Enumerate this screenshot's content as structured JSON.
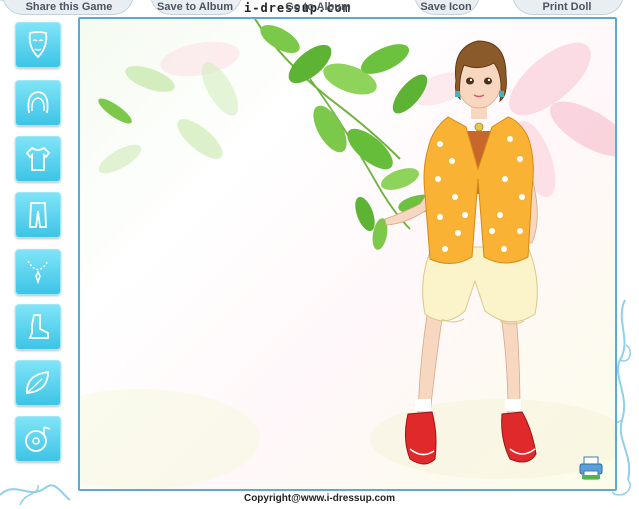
{
  "toolbar": {
    "share_label": "Share this Game",
    "save_album_label": "Save to Album",
    "logo_text": "i-dressup.com",
    "go_album_label": "Go to Album",
    "save_icon_label": "Save Icon",
    "print_label": "Print Doll"
  },
  "sidebar": {
    "items": [
      {
        "icon": "mask-icon",
        "category": "face"
      },
      {
        "icon": "hair-icon",
        "category": "hair"
      },
      {
        "icon": "shirt-icon",
        "category": "tops"
      },
      {
        "icon": "pants-icon",
        "category": "bottoms"
      },
      {
        "icon": "necklace-icon",
        "category": "jewelry"
      },
      {
        "icon": "boot-icon",
        "category": "shoes"
      },
      {
        "icon": "leaf-icon",
        "category": "background"
      },
      {
        "icon": "music-disc-icon",
        "category": "music"
      }
    ]
  },
  "footer": {
    "copyright": "Copyright@www.i-dressup.com"
  },
  "colors": {
    "accent": "#3dc4e6",
    "stage_border": "#5aa9d8",
    "top_orange": "#f9b233",
    "shoe_red": "#e0292b"
  }
}
